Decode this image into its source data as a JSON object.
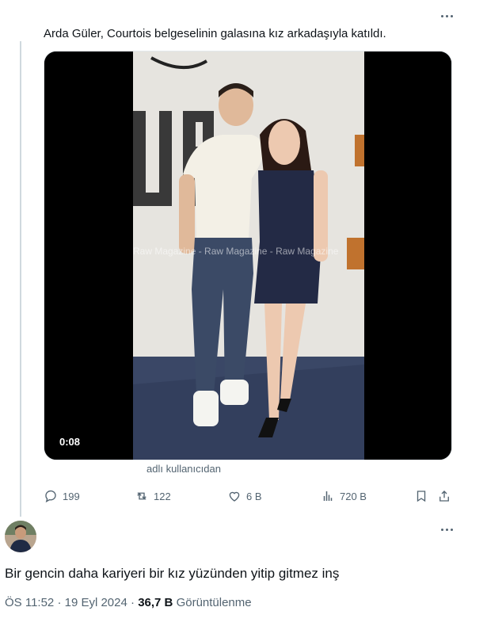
{
  "quoted_tweet": {
    "text": "Arda Güler, Courtois belgeselinin galasına kız arkadaşıyla katıldı.",
    "video": {
      "duration": "0:08",
      "watermark": "Raw Magazine - Raw Magazine - Raw Magazine"
    },
    "attribution": "adlı kullanıcıdan",
    "actions": {
      "replies": "199",
      "retweets": "122",
      "likes": "6 B",
      "views": "720 B"
    }
  },
  "reply": {
    "text": "Bir gencin daha kariyeri bir kız yüzünden yitip gitmez inş",
    "time": "ÖS 11:52",
    "separator": "·",
    "date": "19 Eyl 2024",
    "views_count": "36,7 B",
    "views_label": "Görüntülenme"
  },
  "icons": {
    "more": "more-horizontal-icon",
    "reply": "reply-bubble-icon",
    "retweet": "retweet-icon",
    "like": "heart-icon",
    "views": "bar-chart-icon",
    "bookmark": "bookmark-icon",
    "share": "share-upload-icon"
  },
  "colors": {
    "text_primary": "#0f1419",
    "text_secondary": "#536471",
    "divider": "#cfd9de",
    "video_letterbox": "#000000"
  }
}
